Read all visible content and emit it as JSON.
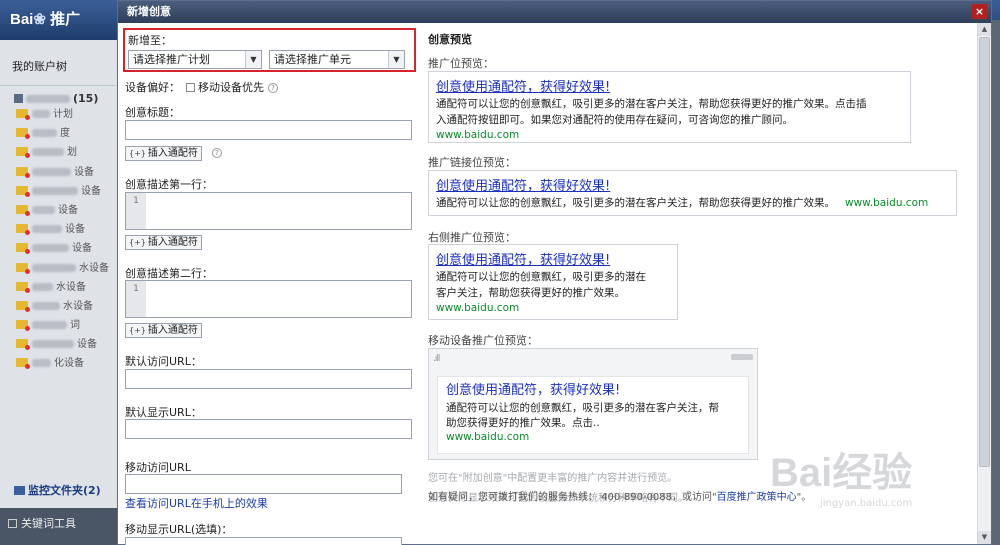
{
  "app": {
    "logo_text": "Bai",
    "logo_suffix": "推广",
    "sidebar_title": "我的账户树",
    "root_count": "(15)",
    "tree_items": [
      "计划",
      "度",
      "划",
      "设备",
      "设备",
      "设备",
      "设备",
      "设备",
      "水设备",
      "水设备",
      "水设备",
      "词",
      "设备",
      "化设备"
    ],
    "monitor_label": "监控文件夹(2)",
    "bottom_tool": "关键词工具"
  },
  "dialog": {
    "title": "新增创意",
    "close": "×"
  },
  "form": {
    "add_to_label": "新增至：",
    "plan_select": "请选择推广计划",
    "unit_select": "请选择推广单元",
    "device_label": "设备偏好：",
    "device_option": "移动设备优先",
    "title_label": "创意标题：",
    "insert_wildcard": "插入通配符",
    "insert_icon": "{+}",
    "desc1_label": "创意描述第一行：",
    "desc2_label": "创意描述第二行：",
    "line_no": "1",
    "default_url_label": "默认访问URL：",
    "display_url_label": "默认显示URL：",
    "mobile_url_label": "移动访问URL",
    "mobile_url_link": "查看访问URL在手机上的效果",
    "mobile_display_label": "移动显示URL(选填)："
  },
  "preview": {
    "heading": "创意预览",
    "top_label": "推广位预览：",
    "link_label": "推广链接位预览：",
    "right_label": "右侧推广位预览：",
    "mobile_label": "移动设备推广位预览：",
    "ad_title": "创意使用通配符，获得好效果!",
    "top_desc_1": "通配符可以让您的创意飘红，吸引更多的潜在客户关注，帮助您获得更好的推广效果。点击插",
    "top_desc_2": "入通配符按钮即可。如果您对通配符的使用存在疑问，可咨询您的推广顾问。",
    "link_desc": "通配符可以让您的创意飘红，吸引更多的潜在客户关注，帮助您获得更好的推广效果。",
    "right_desc_1": "通配符可以让您的创意飘红，吸引更多的潜在",
    "right_desc_2": "客户关注，帮助您获得更好的推广效果。",
    "mobile_desc_1": "通配符可以让您的创意飘红，吸引更多的潜在客户关注，帮",
    "mobile_desc_2": "助您获得更好的推广效果。点击..",
    "url": "www.baidu.com",
    "signal": ".ıll",
    "note_1": "您可在\"附加创意\"中配置更丰富的推广内容并进行预览。",
    "note_2": "创意实际显示效果可能因设备操作系统和分辨率略有不同。",
    "footer_text": "如有疑问，您可拨打我们的服务热线：  400-890-0088，或访问\"",
    "footer_link": "百度推广政策中心",
    "footer_end": "\"。"
  },
  "watermark": {
    "brand": "Bai经验",
    "site": "jingyan.baidu.com"
  },
  "colors": {
    "highlight_border": "#d8232a",
    "link": "#1b2fbf",
    "url": "#0a8a2a",
    "titlebar": "#2f3f5a"
  }
}
